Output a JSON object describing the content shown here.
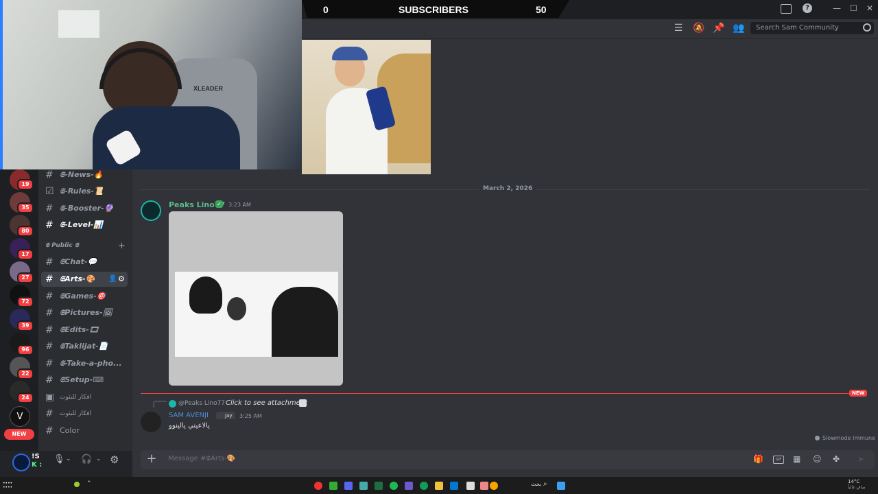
{
  "overlay": {
    "sub_left": "0",
    "sub_title": "SUBSCRIBERS",
    "sub_right": "50",
    "chair_brand": "XLEADER"
  },
  "header": {
    "search_placeholder": "Search Sam Community"
  },
  "servers": [
    {
      "badge": "19"
    },
    {
      "badge": "35"
    },
    {
      "badge": "80"
    },
    {
      "badge": "17"
    },
    {
      "badge": "27"
    },
    {
      "badge": "72"
    },
    {
      "badge": "39"
    },
    {
      "badge": "96"
    },
    {
      "badge": "22"
    },
    {
      "badge": "24"
    },
    {
      "letter": "V"
    },
    {
      "new": "NEW"
    }
  ],
  "channels": {
    "items": [
      {
        "name": "𝕾-News-🔥"
      },
      {
        "name": "𝕾-Rules-📜"
      },
      {
        "name": "𝕾-Booster-🔮"
      },
      {
        "name": "𝕾-Level-📊"
      },
      {
        "name": "𝕾Chat-💬"
      },
      {
        "name": "𝕾Arts-🎨"
      },
      {
        "name": "𝕾Games-🎯"
      },
      {
        "name": "𝕾Pictures-🖼"
      },
      {
        "name": "𝕾Edits-🎞"
      },
      {
        "name": "𝕾Taklijat-📄"
      },
      {
        "name": "𝕾-Take-a-pho..."
      },
      {
        "name": "𝕾Setup-⌨"
      },
      {
        "name": "افكار للبثوث"
      },
      {
        "name": "افكار للبثوث"
      },
      {
        "name": "Color"
      }
    ],
    "category": "𝕾 Public 𝕾"
  },
  "user": {
    "initials_top": "!S",
    "initials_bottom": "K :"
  },
  "chat": {
    "date_divider": "March 2, 2026",
    "msg1_author": "Peaks Lino77",
    "msg1_time": "3:23 AM",
    "reply_author": "@Peaks Lino77",
    "reply_text": "Click to see attachment",
    "msg2_author": "SAM AVENJI",
    "msg2_tag": "Jay",
    "msg2_time": "3:25 AM",
    "msg2_text": "يالاعيني يالينوو",
    "new_label": "NEW",
    "slowmode": "Slowmode Immune"
  },
  "composer": {
    "placeholder": "Message #𝕾Arts-🎨"
  },
  "taskbar": {
    "search_text": "بحث",
    "weather": "14°C",
    "weather_sub": "صافٍ غالباً"
  },
  "colors": {
    "accent_green": "#57f287",
    "name_green": "#5dbb8f",
    "name_blue": "#4f8bd6",
    "badge_red": "#f23f42"
  }
}
